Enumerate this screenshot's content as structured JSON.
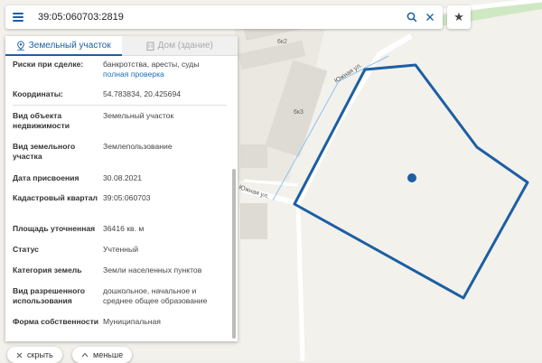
{
  "search": {
    "query": "39:05:060703:2819"
  },
  "tabs": [
    {
      "label": "Земельный участок",
      "active": true
    },
    {
      "label": "Дом (здание)",
      "active": false
    }
  ],
  "map": {
    "street_labels": [
      "Южная ул.",
      "Южная ул."
    ],
    "building_labels": [
      "6к2",
      "6к3"
    ],
    "parcel_color": "#1c5fa3"
  },
  "info": {
    "risks_label": "Риски при сделке:",
    "risks_value": "банкротства, аресты, суды",
    "risks_link": "полная проверка",
    "coords_label": "Координаты:",
    "coords_value": "54.783834, 20.425694",
    "fields": [
      {
        "label": "Вид объекта недвижимости",
        "value": "Земельный участок"
      },
      {
        "label": "Вид земельного участка",
        "value": "Землепользование"
      },
      {
        "label": "Дата присвоения",
        "value": "30.08.2021"
      },
      {
        "label": "Кадастровый квартал",
        "value": "39:05:060703"
      },
      {
        "label": "Площадь уточненная",
        "value": "36416 кв. м"
      },
      {
        "label": "Статус",
        "value": "Учтенный"
      },
      {
        "label": "Категория земель",
        "value": "Земли населенных пунктов"
      },
      {
        "label": "Вид разрешенного использования",
        "value": "дошкольное, начальное и среднее общее образование"
      },
      {
        "label": "Форма собственности",
        "value": "Муниципальная"
      }
    ]
  },
  "footer": {
    "hide_label": "скрыть",
    "less_label": "меньше"
  },
  "colors": {
    "accent": "#1c5fa3",
    "link": "#1c6fb8"
  }
}
